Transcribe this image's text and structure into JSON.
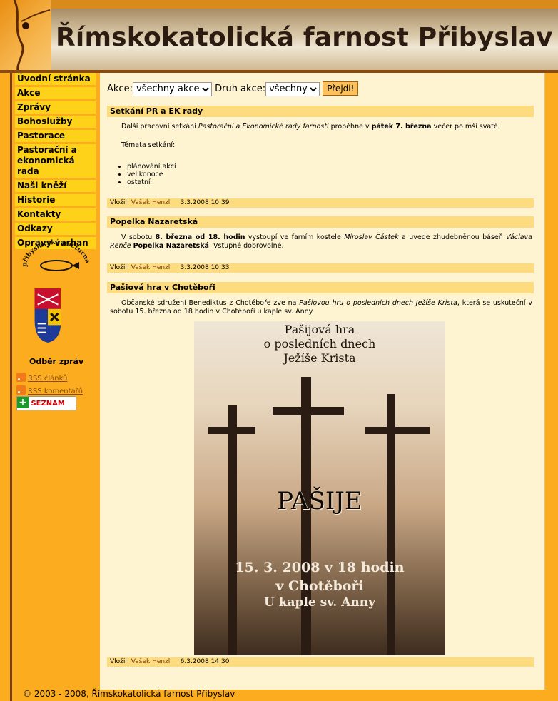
{
  "site": {
    "title": "Římskokatolická farnost Přibyslav"
  },
  "nav": [
    "Úvodní stránka",
    "Akce",
    "Zprávy",
    "Bohoslužby",
    "Pastorace",
    "Pastorační a ekonomická rada",
    "Naši kněží",
    "Historie",
    "Kontakty",
    "Odkazy",
    "Opravy varhan"
  ],
  "sidebar": {
    "logo_text": "přibyslavská nocturna",
    "feeds_title": "Odběr zpráv",
    "rss_articles": "RSS článků",
    "rss_comments": "RSS komentářů",
    "seznam_label": "SEZNAM"
  },
  "filter": {
    "akce_label": "Akce:",
    "akce_value": "všechny akce",
    "druh_label": "Druh akce:",
    "druh_value": "všechny",
    "go_button": "Přejdi!"
  },
  "articles": [
    {
      "title": "Setkání PR a EK rady",
      "body_intro": "Další pracovní setkání ",
      "body_em": "Pastorační a Ekonomické rady farnosti",
      "body_mid": " proběhne v ",
      "body_strong": "pátek 7. března",
      "body_end": " večer po mši svaté.",
      "topics_label": "Témata setkání:",
      "topics": [
        "plánování akcí",
        "velikonoce",
        "ostatní"
      ],
      "meta_label": "Vložil:",
      "author": "Vašek Henzl",
      "date": "3.3.2008 10:39"
    },
    {
      "title": "Popelka Nazaretská",
      "b1": "V sobotu ",
      "b2": "8. března od 18. hodin",
      "b3": " vystoupí ve farním kostele ",
      "b4": "Miroslav Částek",
      "b5": " a uvede zhudebněnou báseň ",
      "b6": "Václava Renče",
      "b7": "Popelka Nazaretská",
      "b8": ". Vstupné dobrovolné.",
      "meta_label": "Vložil:",
      "author": "Vašek Henzl",
      "date": "3.3.2008 10:33"
    },
    {
      "title": "Pašiová hra v Chotěboři",
      "b1": "Občanské sdružení Benediktus z Chotěboře zve na ",
      "b2": "Pašiovou hru o posledních dnech Ježíše Krista",
      "b3": ", která se uskuteční v sobotu 15. března od 18 hodin v Chotěboři u kaple sv. Anny.",
      "poster": {
        "line1": "Pašijová hra",
        "line2": "o posledních dnech",
        "line3": "Ježíše Krista",
        "big": "PAŠIJE",
        "date_line": "15. 3. 2008 v 18 hodin",
        "place_line": "v Chotěboři",
        "chapel_line": "U kaple sv. Anny"
      },
      "meta_label": "Vložil:",
      "author": "Vašek Henzl",
      "date": "6.3.2008 14:30"
    }
  ],
  "footer": "© 2003 - 2008, Římskokatolická farnost Přibyslav"
}
